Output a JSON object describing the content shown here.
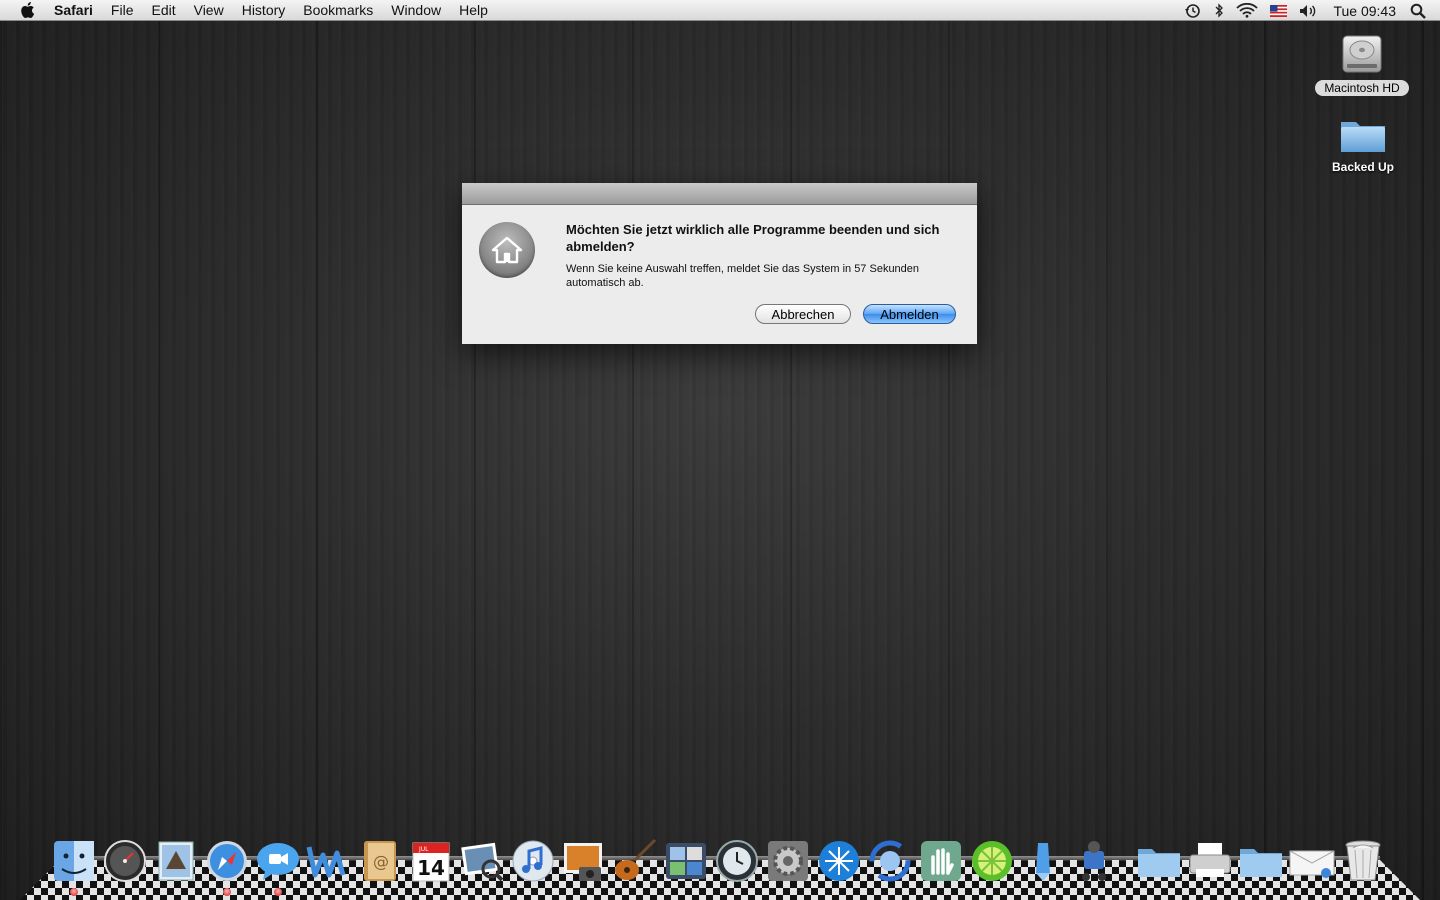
{
  "menubar": {
    "app_name": "Safari",
    "items": [
      "File",
      "Edit",
      "View",
      "History",
      "Bookmarks",
      "Window",
      "Help"
    ],
    "clock": "Tue 09:43"
  },
  "desktop": {
    "icons": [
      {
        "label": "Macintosh HD",
        "icon": "hard-drive-icon"
      },
      {
        "label": "Backed Up",
        "icon": "folder-icon"
      }
    ]
  },
  "dialog": {
    "title": "Möchten Sie jetzt wirklich alle Programme beenden und sich abmelden?",
    "message": "Wenn Sie keine Auswahl treffen, meldet Sie das System in 57 Sekunden automatisch ab.",
    "cancel_label": "Abbrechen",
    "confirm_label": "Abmelden",
    "icon": "home-icon"
  },
  "dock": {
    "calendar_month": "JUL",
    "calendar_day": "14",
    "items": [
      "finder-icon",
      "dashboard-icon",
      "mail-icon",
      "safari-icon",
      "ichat-icon",
      "word-icon",
      "address-book-icon",
      "ical-icon",
      "iphoto-icon",
      "itunes-icon",
      "image-capture-icon",
      "garageband-icon",
      "spaces-icon",
      "time-machine-icon",
      "system-preferences-icon",
      "network-utility-icon",
      "sync-icon",
      "hand-app-icon",
      "limewire-icon",
      "pen-icon",
      "automator-icon",
      "documents-folder-icon",
      "printer-icon",
      "downloads-folder-icon",
      "mail-stack-icon",
      "trash-icon"
    ]
  },
  "colors": {
    "accent": "#3b8ee9",
    "running_indicator": "#d01818"
  }
}
